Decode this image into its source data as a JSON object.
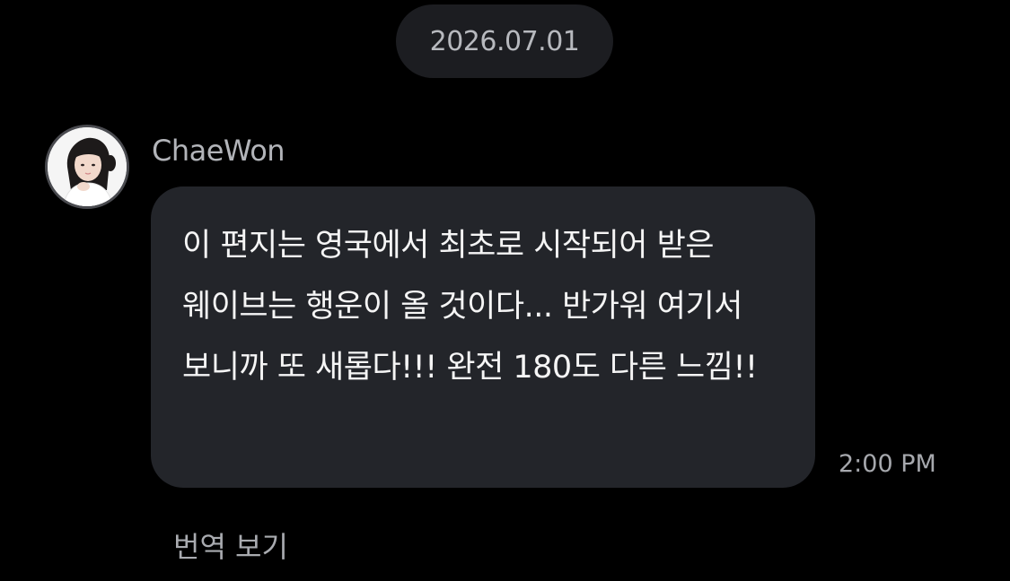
{
  "date_separator": "2026.07.01",
  "message": {
    "sender": "ChaeWon",
    "text": "이 편지는 영국에서 최초로 시작되어 받은 웨이브는 행운이 올 것이다... 반가워 여기서 보니까 또 새롭다!!! 완전 180도 다른 느낌!!",
    "time": "2:00 PM",
    "translate_label": "번역 보기"
  },
  "avatar": {
    "icon": "avatar-photo"
  },
  "colors": {
    "background": "#000000",
    "bubble": "#23252a",
    "date_pill": "#1c1d21",
    "secondary_text": "#b2b4b9"
  }
}
